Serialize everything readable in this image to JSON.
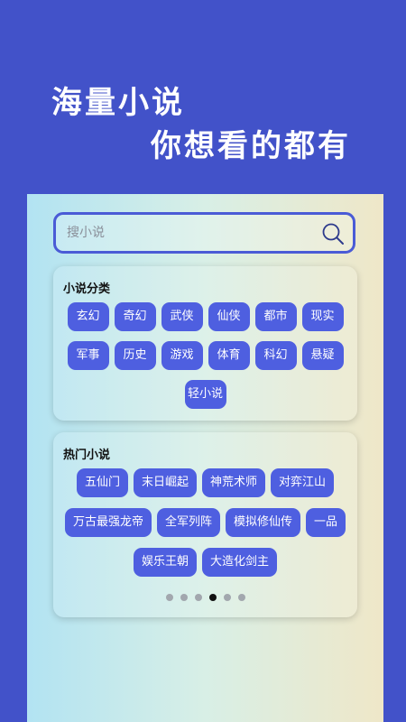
{
  "promo": {
    "line1": "海量小说",
    "line2": "你想看的都有"
  },
  "search": {
    "placeholder": "搜小说",
    "icon": "search-icon"
  },
  "categories": {
    "title": "小说分类",
    "items": [
      "玄幻",
      "奇幻",
      "武侠",
      "仙侠",
      "都市",
      "现实",
      "军事",
      "历史",
      "游戏",
      "体育",
      "科幻",
      "悬疑",
      "轻小说"
    ]
  },
  "hot": {
    "title": "热门小说",
    "items": [
      "五仙门",
      "末日崛起",
      "神荒术师",
      "对弈江山",
      "万古最强龙帝",
      "全军列阵",
      "模拟修仙传",
      "一品",
      "娱乐王朝",
      "大造化剑主"
    ],
    "pagination": {
      "total": 6,
      "active_index": 3
    }
  },
  "colors": {
    "background": "#4252c9",
    "tag": "#4e5fe0",
    "search_border": "#4a5bd6"
  }
}
